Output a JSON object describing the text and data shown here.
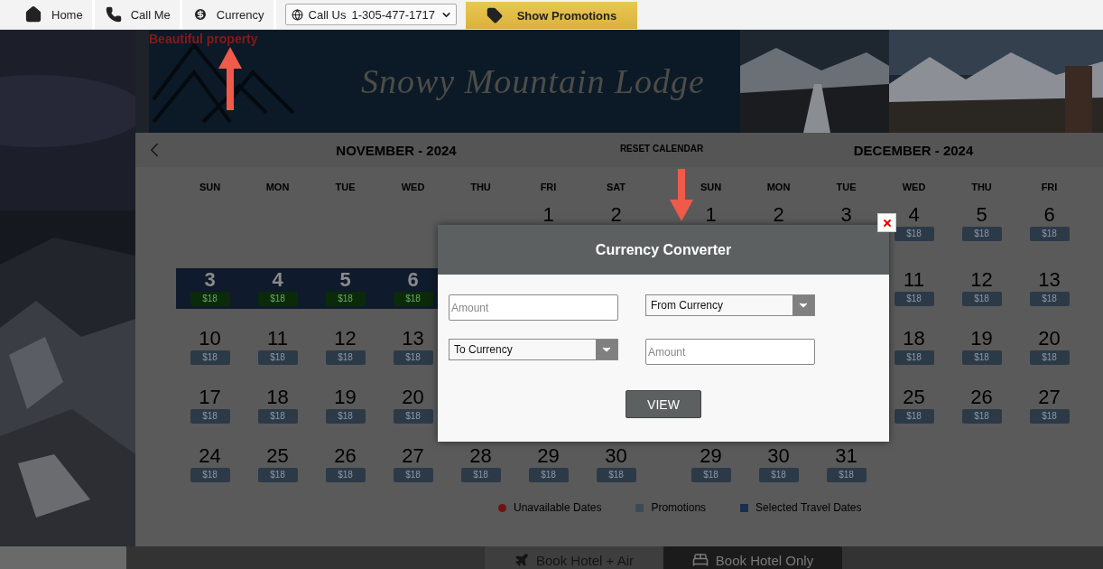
{
  "top_bar": {
    "items": [
      {
        "kind": "home",
        "label": "Home"
      },
      {
        "kind": "phone",
        "label": "Call Me"
      },
      {
        "kind": "currency",
        "label": "Currency"
      }
    ],
    "phone_menu": {
      "label": "Call Us",
      "number": "1-305-477-1717"
    },
    "promo_button": {
      "label": "Show Promotions"
    }
  },
  "banner": {
    "tagline": "Beautiful property",
    "title": "Snowy Mountain Lodge"
  },
  "calendar": {
    "reset": "RESET CALENDAR",
    "months": [
      {
        "title": "NOVEMBER - 2024",
        "weekdays": [
          "SUN",
          "MON",
          "TUE",
          "WED",
          "THU",
          "FRI",
          "SAT"
        ],
        "weeks": [
          [
            {
              "kind": "blank"
            },
            {
              "kind": "blank"
            },
            {
              "kind": "blank"
            },
            {
              "kind": "blank"
            },
            {
              "kind": "blank"
            },
            {
              "kind": "day",
              "day": "1",
              "selected": false
            },
            {
              "kind": "day",
              "day": "2",
              "selected": false
            }
          ],
          [
            {
              "kind": "day",
              "day": "3",
              "price": "$18",
              "selected": true
            },
            {
              "kind": "day",
              "day": "4",
              "price": "$18",
              "selected": true
            },
            {
              "kind": "day",
              "day": "5",
              "price": "$18",
              "selected": true
            },
            {
              "kind": "day",
              "day": "6",
              "price": "$18",
              "selected": true
            }
          ],
          [
            {
              "kind": "day",
              "day": "10",
              "price": "$18",
              "selected": false
            },
            {
              "kind": "day",
              "day": "11",
              "price": "$18",
              "selected": false
            },
            {
              "kind": "day",
              "day": "12",
              "price": "$18",
              "selected": false
            },
            {
              "kind": "day",
              "day": "13",
              "price": "$18",
              "selected": false
            }
          ],
          [
            {
              "kind": "day",
              "day": "17",
              "price": "$18",
              "selected": false
            },
            {
              "kind": "day",
              "day": "18",
              "price": "$18",
              "selected": false
            },
            {
              "kind": "day",
              "day": "19",
              "price": "$18",
              "selected": false
            },
            {
              "kind": "day",
              "day": "20",
              "price": "$18",
              "selected": false
            }
          ],
          [
            {
              "kind": "day",
              "day": "24",
              "price": "$18",
              "selected": false
            },
            {
              "kind": "day",
              "day": "25",
              "price": "$18",
              "selected": false
            },
            {
              "kind": "day",
              "day": "26",
              "price": "$18",
              "selected": false
            },
            {
              "kind": "day",
              "day": "27",
              "price": "$18",
              "selected": false
            },
            {
              "kind": "day",
              "day": "28",
              "price": "$18",
              "selected": false
            },
            {
              "kind": "day",
              "day": "29",
              "price": "$18",
              "selected": false
            },
            {
              "kind": "day",
              "day": "30",
              "price": "$18",
              "selected": false
            }
          ]
        ]
      },
      {
        "title": "DECEMBER - 2024",
        "weekdays": [
          "SUN",
          "MON",
          "TUE",
          "WED",
          "THU",
          "FRI"
        ],
        "weeks": [
          [
            {
              "kind": "day",
              "day": "1",
              "selected": false
            },
            {
              "kind": "day",
              "day": "2",
              "selected": false
            },
            {
              "kind": "day",
              "day": "3",
              "selected": false
            },
            {
              "kind": "day",
              "day": "4",
              "price": "$18",
              "selected": false
            },
            {
              "kind": "day",
              "day": "5",
              "price": "$18",
              "selected": false
            },
            {
              "kind": "day",
              "day": "6",
              "price": "$18",
              "selected": false
            }
          ],
          [
            {
              "kind": "blank"
            },
            {
              "kind": "blank"
            },
            {
              "kind": "blank"
            },
            {
              "kind": "day",
              "day": "11",
              "price": "$18",
              "selected": false
            },
            {
              "kind": "day",
              "day": "12",
              "price": "$18",
              "selected": false
            },
            {
              "kind": "day",
              "day": "13",
              "price": "$18",
              "selected": false
            }
          ],
          [
            {
              "kind": "blank"
            },
            {
              "kind": "blank"
            },
            {
              "kind": "blank"
            },
            {
              "kind": "day",
              "day": "18",
              "price": "$18",
              "selected": false
            },
            {
              "kind": "day",
              "day": "19",
              "price": "$18",
              "selected": false
            },
            {
              "kind": "day",
              "day": "20",
              "price": "$18",
              "selected": false
            }
          ],
          [
            {
              "kind": "blank"
            },
            {
              "kind": "blank"
            },
            {
              "kind": "blank"
            },
            {
              "kind": "day",
              "day": "25",
              "price": "$18",
              "selected": false
            },
            {
              "kind": "day",
              "day": "26",
              "price": "$18",
              "selected": false
            },
            {
              "kind": "day",
              "day": "27",
              "price": "$18",
              "selected": false
            }
          ],
          [
            {
              "kind": "day",
              "day": "29",
              "price": "$18",
              "selected": false
            },
            {
              "kind": "day",
              "day": "30",
              "price": "$18",
              "selected": false
            },
            {
              "kind": "day",
              "day": "31",
              "price": "$18",
              "selected": false
            }
          ]
        ]
      }
    ],
    "legend": [
      {
        "kind": "dot",
        "label": "Unavailable Dates",
        "color": "#6e1414"
      },
      {
        "kind": "square",
        "label": "Promotions",
        "color": "#3c4a58"
      },
      {
        "kind": "square",
        "label": "Selected Travel Dates",
        "color": "#1a2f4e"
      }
    ]
  },
  "booking_tabs": [
    {
      "kind": "air",
      "label": "Book Hotel + Air",
      "selected": true
    },
    {
      "kind": "hotel",
      "label": "Book Hotel Only",
      "selected": false
    }
  ],
  "modal": {
    "title": "Currency Converter",
    "fields": [
      {
        "kind": "input",
        "placeholder": "Amount"
      },
      {
        "kind": "select",
        "value": "From Currency"
      },
      {
        "kind": "select",
        "value": "To Currency"
      },
      {
        "kind": "input",
        "placeholder": "Amount"
      }
    ],
    "button": "VIEW"
  }
}
